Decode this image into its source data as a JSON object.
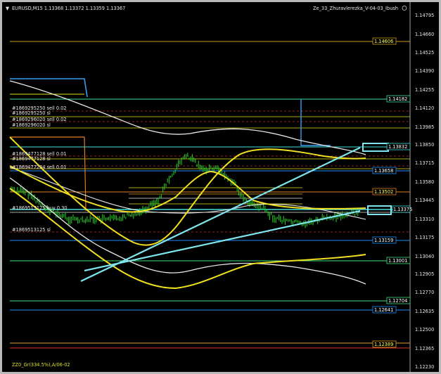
{
  "header": {
    "symbol_line": "EURUSD,M15  1.13368 1.13372 1.13359 1.13367",
    "indicator_name": "Ze_33_Zhuravlerezka_V-04-03_Ibush"
  },
  "footer": {
    "label": "ZZ0_Gr(334.5%),A/06-02"
  },
  "price_axis": {
    "ticks": [
      "1.14795",
      "1.14660",
      "1.14525",
      "1.14390",
      "1.14255",
      "1.14120",
      "1.13985",
      "1.13850",
      "1.13715",
      "1.13580",
      "1.13445",
      "1.13310",
      "1.13175",
      "1.13040",
      "1.12905",
      "1.12770",
      "1.12635",
      "1.12500",
      "1.12365",
      "1.12230"
    ]
  },
  "levels": [
    {
      "label": "1.14606",
      "color": "#c8a020",
      "text_color": "#ffff55"
    },
    {
      "label": "1.14182",
      "color": "#40e0a0",
      "text_color": "#ffffff"
    },
    {
      "label": "1.13832",
      "color": "#40e0e0",
      "text_color": "#ffffff"
    },
    {
      "label": "1.13658",
      "color": "#1e90ff",
      "text_color": "#ffffff"
    },
    {
      "label": "1.13502",
      "color": "#e08020",
      "text_color": "#ffff55"
    },
    {
      "label": "1.13375",
      "color": "#40e0e0",
      "text_color": "#ffffff"
    },
    {
      "label": "1.13159",
      "color": "#1e90ff",
      "text_color": "#ffffff"
    },
    {
      "label": "1.13001",
      "color": "#40e080",
      "text_color": "#ffffff"
    },
    {
      "label": "1.12704",
      "color": "#40e080",
      "text_color": "#ffffff"
    },
    {
      "label": "1.12641",
      "color": "#1e90ff",
      "text_color": "#ffffff"
    },
    {
      "label": "1.12389",
      "color": "#e0a020",
      "text_color": "#ffff55"
    }
  ],
  "order_labels": [
    "#1869295250 sell 0.02",
    "#1869295250 sl",
    "#1869296020 sell 0.02",
    "#1869296020 sl",
    "#1869477128 sell 0.01",
    "#1869477128 sl",
    "#1869477204 sell 0.01",
    "#1869513125 buy 0.30",
    "#1869513125 sl"
  ],
  "colors": {
    "background": "#000000",
    "candle": "#22c522",
    "ma_yellow": "#f0e020",
    "ma_white": "#e8e8e8",
    "trend_line": "#7fe6f0"
  }
}
